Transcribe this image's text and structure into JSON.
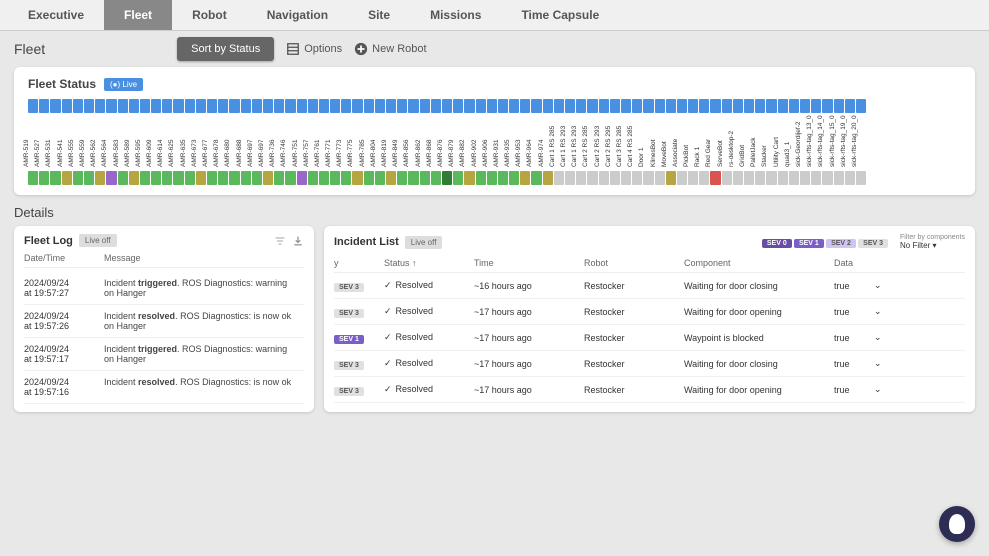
{
  "tabs": [
    "Executive",
    "Fleet",
    "Robot",
    "Navigation",
    "Site",
    "Missions",
    "Time Capsule"
  ],
  "active_tab": 1,
  "fleet": {
    "title": "Fleet",
    "sort_label": "Sort by Status",
    "options_label": "Options",
    "new_robot_label": "New Robot"
  },
  "fleet_status": {
    "title": "Fleet Status",
    "live_label": "(●) Live",
    "robots": [
      {
        "name": "AMR-519",
        "c": "green"
      },
      {
        "name": "AMR-527",
        "c": "green"
      },
      {
        "name": "AMR-531",
        "c": "green"
      },
      {
        "name": "AMR-541",
        "c": "olive"
      },
      {
        "name": "AMR-555",
        "c": "green"
      },
      {
        "name": "AMR-559",
        "c": "green"
      },
      {
        "name": "AMR-562",
        "c": "olive"
      },
      {
        "name": "AMR-564",
        "c": "purple"
      },
      {
        "name": "AMR-583",
        "c": "green"
      },
      {
        "name": "AMR-589",
        "c": "olive"
      },
      {
        "name": "AMR-595",
        "c": "green"
      },
      {
        "name": "AMR-609",
        "c": "green"
      },
      {
        "name": "AMR-614",
        "c": "green"
      },
      {
        "name": "AMR-625",
        "c": "green"
      },
      {
        "name": "AMR-635",
        "c": "green"
      },
      {
        "name": "AMR-673",
        "c": "olive"
      },
      {
        "name": "AMR-677",
        "c": "green"
      },
      {
        "name": "AMR-678",
        "c": "green"
      },
      {
        "name": "AMR-680",
        "c": "green"
      },
      {
        "name": "AMR-688",
        "c": "green"
      },
      {
        "name": "AMR-697",
        "c": "green"
      },
      {
        "name": "AMR-697",
        "c": "olive"
      },
      {
        "name": "AMR-736",
        "c": "green"
      },
      {
        "name": "AMR-746",
        "c": "green"
      },
      {
        "name": "AMR-751",
        "c": "purple"
      },
      {
        "name": "AMR-757",
        "c": "green"
      },
      {
        "name": "AMR-761",
        "c": "green"
      },
      {
        "name": "AMR-771",
        "c": "green"
      },
      {
        "name": "AMR-773",
        "c": "green"
      },
      {
        "name": "AMR-775",
        "c": "olive"
      },
      {
        "name": "AMR-785",
        "c": "green"
      },
      {
        "name": "AMR-804",
        "c": "green"
      },
      {
        "name": "AMR-819",
        "c": "olive"
      },
      {
        "name": "AMR-849",
        "c": "green"
      },
      {
        "name": "AMR-856",
        "c": "green"
      },
      {
        "name": "AMR-862",
        "c": "green"
      },
      {
        "name": "AMR-868",
        "c": "green"
      },
      {
        "name": "AMR-876",
        "c": "dgreen"
      },
      {
        "name": "AMR-879",
        "c": "green"
      },
      {
        "name": "AMR-882",
        "c": "olive"
      },
      {
        "name": "AMR-902",
        "c": "green"
      },
      {
        "name": "AMR-906",
        "c": "green"
      },
      {
        "name": "AMR-931",
        "c": "green"
      },
      {
        "name": "AMR-935",
        "c": "green"
      },
      {
        "name": "AMR-953",
        "c": "olive"
      },
      {
        "name": "AMR-964",
        "c": "green"
      },
      {
        "name": "AMR-974",
        "c": "olive"
      },
      {
        "name": "Cart 1 RS 285",
        "c": "gray"
      },
      {
        "name": "Cart 1 RS 293",
        "c": "gray"
      },
      {
        "name": "Cart 1 RS 293",
        "c": "gray"
      },
      {
        "name": "Cart 2 RS 285",
        "c": "gray"
      },
      {
        "name": "Cart 2 RS 293",
        "c": "gray"
      },
      {
        "name": "Cart 2 RS 295",
        "c": "gray"
      },
      {
        "name": "Cart 3 RS 285",
        "c": "gray"
      },
      {
        "name": "Cart 4 RS 285",
        "c": "gray"
      },
      {
        "name": "Door 1",
        "c": "gray"
      },
      {
        "name": "KlinesBot",
        "c": "gray"
      },
      {
        "name": "MoveBot",
        "c": "olive"
      },
      {
        "name": "Associate",
        "c": "gray"
      },
      {
        "name": "PickBot",
        "c": "gray"
      },
      {
        "name": "Rack 1",
        "c": "gray"
      },
      {
        "name": "Red Gear",
        "c": "red"
      },
      {
        "name": "ServeBot",
        "c": "gray"
      },
      {
        "name": "rs-desktop-2",
        "c": "gray"
      },
      {
        "name": "GridBot",
        "c": "gray"
      },
      {
        "name": "PalletJack",
        "c": "gray"
      },
      {
        "name": "Stacker",
        "c": "gray"
      },
      {
        "name": "Utility Cart",
        "c": "gray"
      },
      {
        "name": "quad3_1",
        "c": "gray"
      },
      {
        "name": "sick-Geordijef-2",
        "c": "gray"
      },
      {
        "name": "sick-rfts-tag_13_0",
        "c": "gray"
      },
      {
        "name": "sick-rfts-tag_14_0",
        "c": "gray"
      },
      {
        "name": "sick-rfts-tag_15_0",
        "c": "gray"
      },
      {
        "name": "sick-rfts-tag_19_0",
        "c": "gray"
      },
      {
        "name": "sick-rfts-tag_20_0",
        "c": "gray"
      }
    ]
  },
  "details_title": "Details",
  "fleet_log": {
    "title": "Fleet Log",
    "liveoff_label": "Live off",
    "cols": {
      "date": "Date/Time",
      "msg": "Message"
    },
    "entries": [
      {
        "dt": "2024/09/24\nat 19:57:27",
        "msg": "Incident triggered. ROS Diagnostics: warning\non Hanger"
      },
      {
        "dt": "2024/09/24\nat 19:57:26",
        "msg": "Incident resolved. ROS Diagnostics: is now ok\non Hanger"
      },
      {
        "dt": "2024/09/24\nat 19:57:17",
        "msg": "Incident triggered. ROS Diagnostics: warning\non Hanger"
      },
      {
        "dt": "2024/09/24\nat 19:57:16",
        "msg": "Incident resolved. ROS Diagnostics: is now ok"
      }
    ]
  },
  "incident_list": {
    "title": "Incident List",
    "liveoff_label": "Live off",
    "sev_chips": [
      "SEV 0",
      "SEV 1",
      "SEV 2",
      "SEV 3"
    ],
    "filter_heading": "Filter by components",
    "filter_value": "No Filter",
    "cols": {
      "y": "y",
      "status": "Status ↑",
      "time": "Time",
      "robot": "Robot",
      "comp": "Component",
      "data": "Data"
    },
    "rows": [
      {
        "sev": "SEV 3",
        "sevc": "sev3",
        "status": "Resolved",
        "time": "~16 hours ago",
        "robot": "Restocker",
        "comp": "Waiting for door closing",
        "data": "true"
      },
      {
        "sev": "SEV 3",
        "sevc": "sev3",
        "status": "Resolved",
        "time": "~17 hours ago",
        "robot": "Restocker",
        "comp": "Waiting for door opening",
        "data": "true"
      },
      {
        "sev": "SEV 1",
        "sevc": "sev1",
        "status": "Resolved",
        "time": "~17 hours ago",
        "robot": "Restocker",
        "comp": "Waypoint is blocked",
        "data": "true"
      },
      {
        "sev": "SEV 3",
        "sevc": "sev3",
        "status": "Resolved",
        "time": "~17 hours ago",
        "robot": "Restocker",
        "comp": "Waiting for door closing",
        "data": "true"
      },
      {
        "sev": "SEV 3",
        "sevc": "sev3",
        "status": "Resolved",
        "time": "~17 hours ago",
        "robot": "Restocker",
        "comp": "Waiting for door opening",
        "data": "true"
      }
    ]
  }
}
